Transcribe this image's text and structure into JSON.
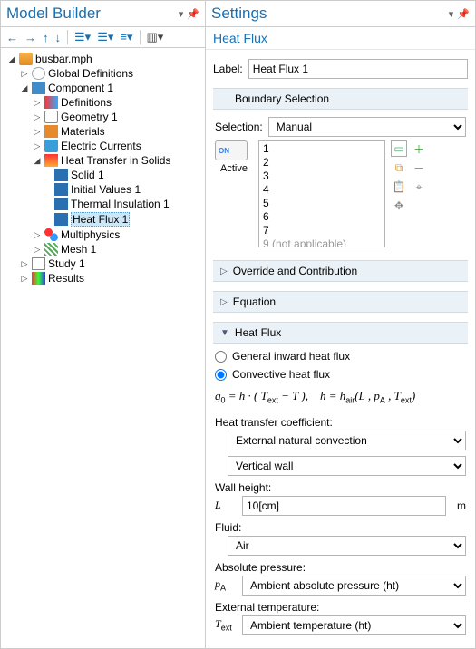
{
  "left": {
    "title": "Model Builder",
    "tree": {
      "root": "busbar.mph",
      "global": "Global Definitions",
      "comp": "Component 1",
      "defs": "Definitions",
      "geom": "Geometry 1",
      "mats": "Materials",
      "ec": "Electric Currents",
      "ht": "Heat Transfer in Solids",
      "solid": "Solid 1",
      "ivals": "Initial Values 1",
      "tins": "Thermal Insulation 1",
      "hf": "Heat Flux 1",
      "multi": "Multiphysics",
      "mesh": "Mesh 1",
      "study": "Study 1",
      "results": "Results"
    }
  },
  "right": {
    "title": "Settings",
    "subtitle": "Heat Flux",
    "label_text": "Label:",
    "label_value": "Heat Flux 1",
    "boundary_head": "Boundary Selection",
    "sel_label": "Selection:",
    "sel_value": "Manual",
    "active_label": "Active",
    "list_items": [
      "1",
      "2",
      "3",
      "4",
      "5",
      "6",
      "7"
    ],
    "list_na": "9 (not applicable)",
    "sect_override": "Override and Contribution",
    "sect_eq": "Equation",
    "sect_hf": "Heat Flux",
    "radio_general": "General inward heat flux",
    "radio_conv": "Convective heat flux",
    "equation": "q₀ = h · ( Tₑₓₜ − T ),    h = hₐᵢᵣ(L , p_A , Tₑₓₜ)",
    "lbl_coef": "Heat transfer coefficient:",
    "combo_coef": "External natural convection",
    "combo_wall_type": "Vertical wall",
    "lbl_wallh": "Wall height:",
    "sym_L": "L",
    "val_wallh": "10[cm]",
    "unit_wallh": "m",
    "lbl_fluid": "Fluid:",
    "combo_fluid": "Air",
    "lbl_absP": "Absolute pressure:",
    "sym_pA": "p_A",
    "combo_absP": "Ambient absolute pressure (ht)",
    "lbl_extT": "External temperature:",
    "sym_Text": "Tₑₓₜ",
    "combo_extT": "Ambient temperature (ht)"
  }
}
